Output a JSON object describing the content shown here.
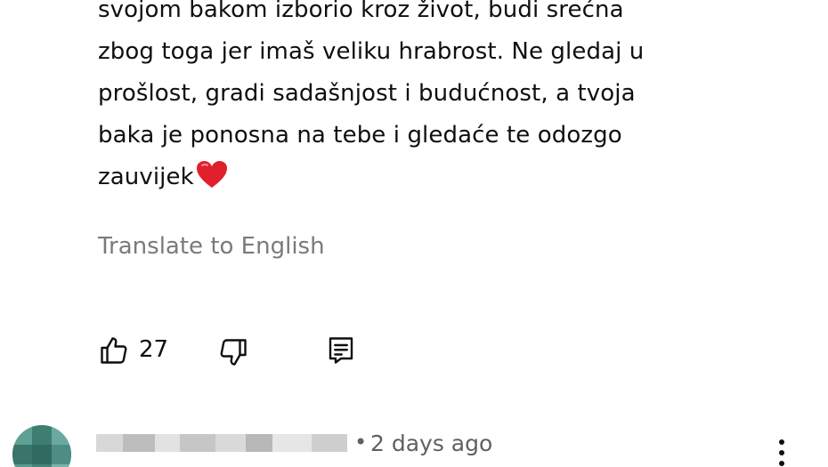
{
  "comment": {
    "lines": [
      "svojom bakom izborio kroz život, budi srećna",
      "zbog toga jer imaš veliku hrabrost. Ne gledaj u",
      "prošlost, gradi sadašnjost i budućnost, a tvoja",
      "baka je ponosna na tebe i gledaće te odozgo",
      "zauvijek"
    ],
    "emoji": "heart-emoji",
    "translate_label": "Translate to English"
  },
  "actions": {
    "like_icon": "thumbs-up-icon",
    "like_count": "27",
    "dislike_icon": "thumbs-down-icon",
    "reply_icon": "reply-comment-icon"
  },
  "next_comment": {
    "separator": "•",
    "timestamp": "2 days ago",
    "more_icon": "more-vertical-icon"
  },
  "colors": {
    "text": "#0f0f0f",
    "secondary": "#606060",
    "translate": "#7a7a7a",
    "heart": "#e0202c"
  }
}
